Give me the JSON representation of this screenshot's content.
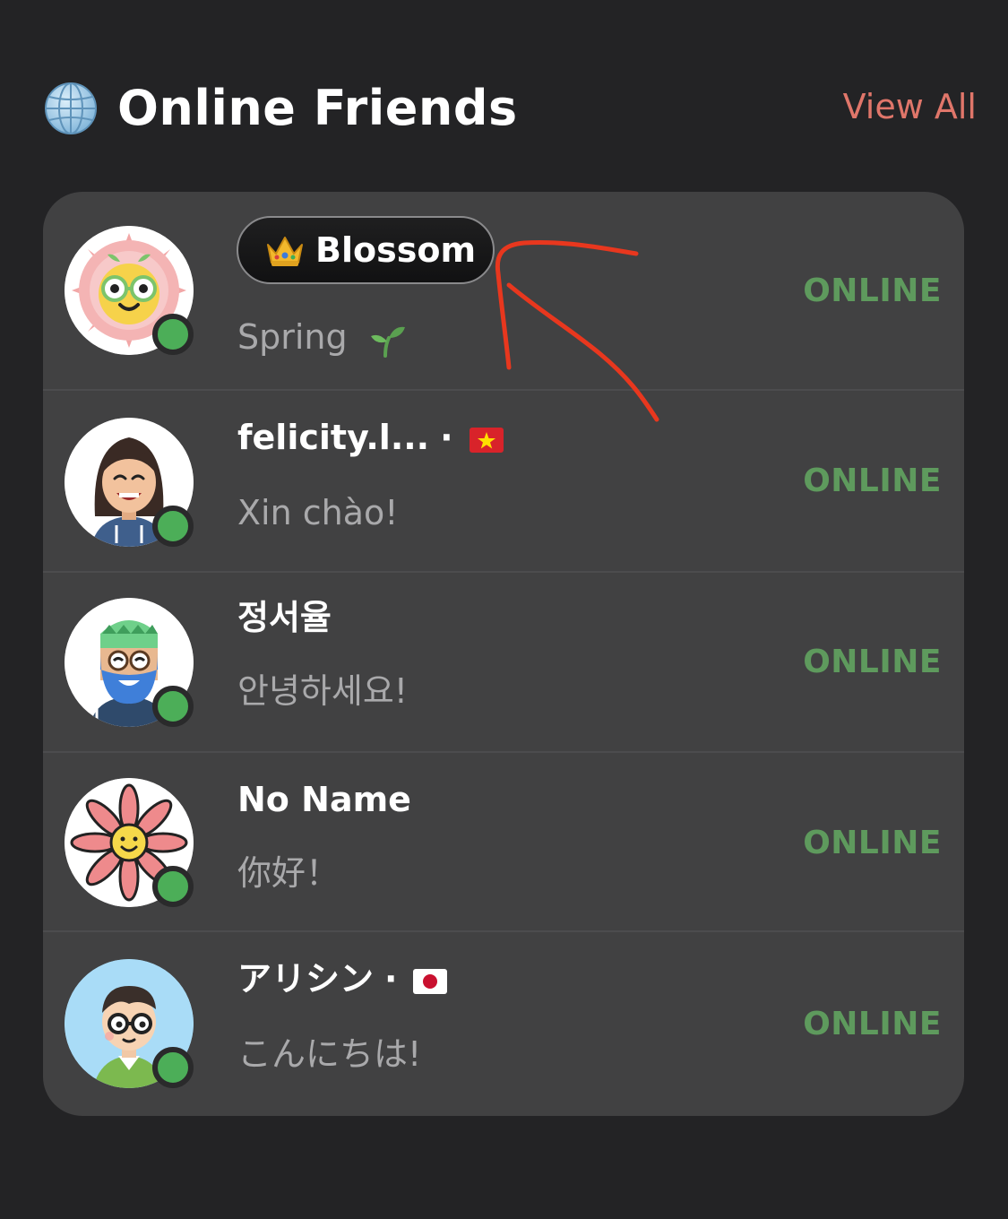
{
  "header": {
    "icon": "globe-icon",
    "title": "Online Friends",
    "view_all": "View All"
  },
  "friends": [
    {
      "name": "Blossom",
      "badge_icon": "crown-icon",
      "message": "Spring",
      "message_icon": "seedling-icon",
      "status": "ONLINE"
    },
    {
      "name": "felicity.l...",
      "separator": "·",
      "flag": "vietnam-flag-icon",
      "message": "Xin chào!",
      "status": "ONLINE"
    },
    {
      "name": "정서율",
      "message": "안녕하세요!",
      "status": "ONLINE"
    },
    {
      "name": "No Name",
      "message": "你好！",
      "status": "ONLINE"
    },
    {
      "name": "アリシン",
      "separator": "·",
      "flag": "japan-flag-icon",
      "message": "こんにちは!",
      "status": "ONLINE"
    }
  ],
  "colors": {
    "background": "#232325",
    "card": "#414142",
    "accent_link": "#e0766a",
    "online_text": "#5e9a5d",
    "online_dot": "#4cae58",
    "annotation": "#e8371e"
  }
}
